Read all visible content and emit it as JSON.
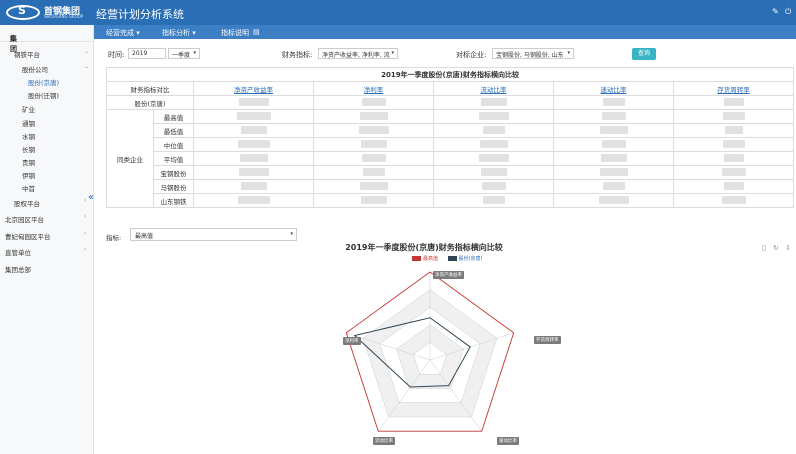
{
  "header": {
    "logo_text": "首钢集团",
    "logo_sub": "SHOUGANG GROUP",
    "title": "经营计划分析系统"
  },
  "menu": [
    {
      "label": "经营完成 ▾"
    },
    {
      "label": "指标分析 ▾"
    },
    {
      "label": "指标说明"
    }
  ],
  "sidebar": {
    "header": "集团",
    "items": [
      {
        "label": "钢铁平台",
        "arrow": "⌄"
      },
      {
        "label": "股份公司",
        "arrow": "⌄"
      },
      {
        "label": "股份(京唐)"
      },
      {
        "label": "股份(迁钢)"
      },
      {
        "label": "矿业"
      },
      {
        "label": "通钢"
      },
      {
        "label": "水钢"
      },
      {
        "label": "长钢"
      },
      {
        "label": "贵钢"
      },
      {
        "label": "伊钢"
      },
      {
        "label": "中首"
      },
      {
        "label": "股权平台",
        "arrow": "›"
      },
      {
        "label": "北京园区平台",
        "arrow": "›"
      },
      {
        "label": "曹妃甸园区平台",
        "arrow": "›"
      },
      {
        "label": "直管单位",
        "arrow": "›"
      },
      {
        "label": "集团总部"
      }
    ]
  },
  "filters": {
    "period_label": "时间:",
    "year": "2019",
    "quarter": "一季度",
    "indicator_label": "财务指标:",
    "indicator_value": "净资产收益率, 净利率, 流",
    "company_label": "对标企业:",
    "company_value": "宝钢股份, 马钢股份, 山东",
    "query_label": "查询"
  },
  "table": {
    "title": "2019年一季度股份(京唐)财务指标横向比较",
    "corner": "财务指标对比",
    "columns": [
      "净资产收益率",
      "净利率",
      "流动比率",
      "速动比率",
      "存货周转率"
    ],
    "self_row": "股份(京唐)",
    "group_label": "同类企业",
    "rows": [
      "最高值",
      "最低值",
      "中位值",
      "平均值",
      "宝钢股份",
      "马钢股份",
      "山东钢铁"
    ]
  },
  "chart_controls": {
    "select_label": "指标:",
    "select_value": "最高值"
  },
  "chart_data": {
    "type": "radar",
    "title": "2019年一季度股份(京唐)财务指标横向比较",
    "axes": [
      "净资产收益率",
      "净利率",
      "流动比率",
      "速动比率",
      "存货周转率"
    ],
    "series": [
      {
        "name": "最高值",
        "color": "#c23531",
        "values": [
          1.0,
          1.0,
          1.0,
          1.0,
          1.0
        ]
      },
      {
        "name": "股份(京唐)",
        "color": "#2f4554",
        "values": [
          0.48,
          0.9,
          0.38,
          0.36,
          0.48
        ]
      }
    ],
    "grid_levels": 5
  },
  "colors": {
    "topbar": "#2a6eb5",
    "accent": "#39b4c4"
  }
}
